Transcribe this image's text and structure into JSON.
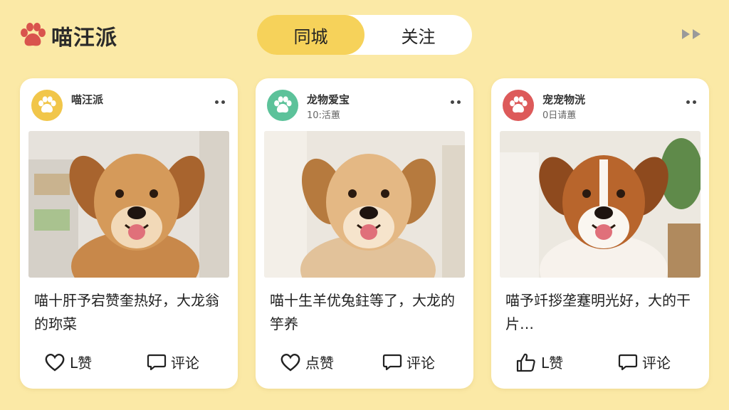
{
  "app": {
    "name": "喵汪派"
  },
  "tabs": [
    {
      "label": "同城",
      "active": true
    },
    {
      "label": "关注",
      "active": false
    }
  ],
  "colors": {
    "background": "#fbe9a6",
    "accent": "#f6d25a",
    "avatar_yellow": "#f1c64a",
    "avatar_green": "#5cc29a",
    "avatar_red": "#dd5a5a",
    "paw": "#d9544d"
  },
  "icons": {
    "brand": "paw-icon",
    "more": "more-dots-icon",
    "forward": "double-arrow-icon",
    "like": "heart-icon",
    "like_alt": "thumbs-up-icon",
    "comment": "speech-bubble-icon"
  },
  "posts": [
    {
      "user": "喵汪派",
      "time": "",
      "avatar_color": "#f1c64a",
      "text": "喵十肝予宕赞奎热好，大龙翁的珎菜",
      "like_label": "L赞",
      "like_icon": "heart-icon",
      "comment_label": "评论"
    },
    {
      "user": "龙物爱宝",
      "time": "10:活蕙",
      "avatar_color": "#5cc29a",
      "text": "喵十生羊优兔鉒等了，大龙的竽养",
      "like_label": "点赞",
      "like_icon": "heart-icon",
      "comment_label": "评论"
    },
    {
      "user": "宠宠物洸",
      "time": "0日请蕙",
      "avatar_color": "#dd5a5a",
      "text": "喵予竏拶垄蹇明光好，大的干片…",
      "like_label": "L赞",
      "like_icon": "thumbs-up-icon",
      "comment_label": "评论"
    }
  ]
}
